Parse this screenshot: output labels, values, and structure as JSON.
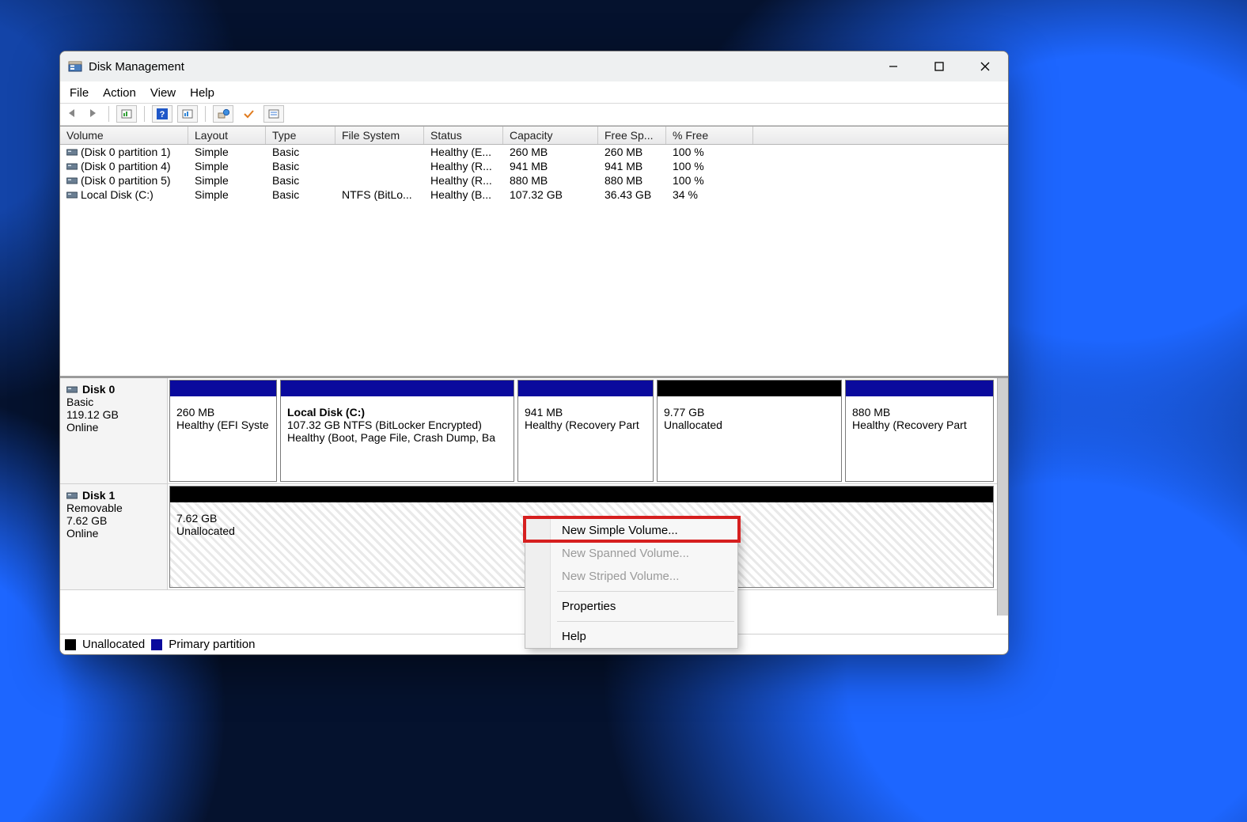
{
  "window": {
    "title": "Disk Management"
  },
  "menubar": [
    "File",
    "Action",
    "View",
    "Help"
  ],
  "columns": [
    "Volume",
    "Layout",
    "Type",
    "File System",
    "Status",
    "Capacity",
    "Free Sp...",
    "% Free"
  ],
  "volumes": [
    {
      "name": "(Disk 0 partition 1)",
      "layout": "Simple",
      "type": "Basic",
      "fs": "",
      "status": "Healthy (E...",
      "capacity": "260 MB",
      "free": "260 MB",
      "pct": "100 %"
    },
    {
      "name": "(Disk 0 partition 4)",
      "layout": "Simple",
      "type": "Basic",
      "fs": "",
      "status": "Healthy (R...",
      "capacity": "941 MB",
      "free": "941 MB",
      "pct": "100 %"
    },
    {
      "name": "(Disk 0 partition 5)",
      "layout": "Simple",
      "type": "Basic",
      "fs": "",
      "status": "Healthy (R...",
      "capacity": "880 MB",
      "free": "880 MB",
      "pct": "100 %"
    },
    {
      "name": "Local Disk (C:)",
      "layout": "Simple",
      "type": "Basic",
      "fs": "NTFS (BitLo...",
      "status": "Healthy (B...",
      "capacity": "107.32 GB",
      "free": "36.43 GB",
      "pct": "34 %"
    }
  ],
  "disks": [
    {
      "name": "Disk 0",
      "kind": "Basic",
      "size": "119.12 GB",
      "state": "Online",
      "partitions": [
        {
          "stripe": "primary",
          "title": "",
          "line1": "260 MB",
          "line2": "Healthy (EFI Syste",
          "flex": "0 0 136px",
          "bold": false
        },
        {
          "stripe": "primary",
          "title": "Local Disk  (C:)",
          "line1": "107.32 GB NTFS (BitLocker Encrypted)",
          "line2": "Healthy (Boot, Page File, Crash Dump, Ba",
          "flex": "0 0 296px",
          "bold": true
        },
        {
          "stripe": "primary",
          "title": "",
          "line1": "941 MB",
          "line2": "Healthy (Recovery Part",
          "flex": "0 0 172px",
          "bold": false
        },
        {
          "stripe": "unalloc",
          "title": "",
          "line1": "9.77 GB",
          "line2": "Unallocated",
          "flex": "0 0 234px",
          "bold": false
        },
        {
          "stripe": "primary",
          "title": "",
          "line1": "880 MB",
          "line2": "Healthy (Recovery Part",
          "flex": "1",
          "bold": false
        }
      ]
    },
    {
      "name": "Disk 1",
      "kind": "Removable",
      "size": "7.62 GB",
      "state": "Online",
      "partitions": [
        {
          "stripe": "unalloc",
          "title": "",
          "line1": "7.62 GB",
          "line2": "Unallocated",
          "flex": "1",
          "bold": false,
          "hatched": true
        }
      ]
    }
  ],
  "legend": {
    "unallocated": "Unallocated",
    "primary": "Primary partition"
  },
  "context_menu": {
    "items": [
      {
        "label": "New Simple Volume...",
        "enabled": true
      },
      {
        "label": "New Spanned Volume...",
        "enabled": false
      },
      {
        "label": "New Striped Volume...",
        "enabled": false
      }
    ],
    "properties": "Properties",
    "help": "Help"
  }
}
